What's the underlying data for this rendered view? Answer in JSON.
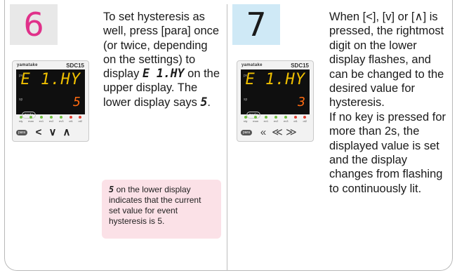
{
  "step6": {
    "number": "6",
    "text_a": "To set hysteresis as well, press [para] once (or twice, depending on the settings) to display ",
    "upper_code": "E 1.HY",
    "text_b": " on the upper display. The lower display says ",
    "lower_code": "5",
    "text_c": ".",
    "note_code": "5",
    "note_text": " on the lower display indicates that the current set value for event hysteresis is 5.",
    "device": {
      "brand": "yamatake",
      "model": "SDC15",
      "pv_label": "pv",
      "sp_label": "sp",
      "upper": "E 1.HY",
      "lower": "5",
      "mode_label": "mode",
      "para_label": "para",
      "keys": [
        "<",
        "∨",
        "∧"
      ]
    }
  },
  "step7": {
    "number": "7",
    "text": "When [<], [v] or [∧] is pressed, the rightmost digit on the lower display flashes, and can be changed to the desired value for hysteresis.",
    "text_b": "If no key is pressed for more than 2s, the displayed value is set and the display changes from flashing to continuously lit.",
    "device": {
      "brand": "yamatake",
      "model": "SDC15",
      "pv_label": "pv",
      "sp_label": "sp",
      "upper": "E 1.HY",
      "lower": "3",
      "mode_label": "mode",
      "para_label": "para",
      "keys": [
        "«",
        "≪",
        "≫"
      ]
    }
  },
  "leds": [
    "rdy",
    "man",
    "ev1",
    "ev2",
    "ev3",
    "ot1",
    "ot2"
  ],
  "colors": {
    "accent_pink": "#e0318a",
    "step6_bg": "#e8e8e8",
    "step7_bg": "#cfe9f6",
    "note_bg": "#fbe1e7"
  }
}
